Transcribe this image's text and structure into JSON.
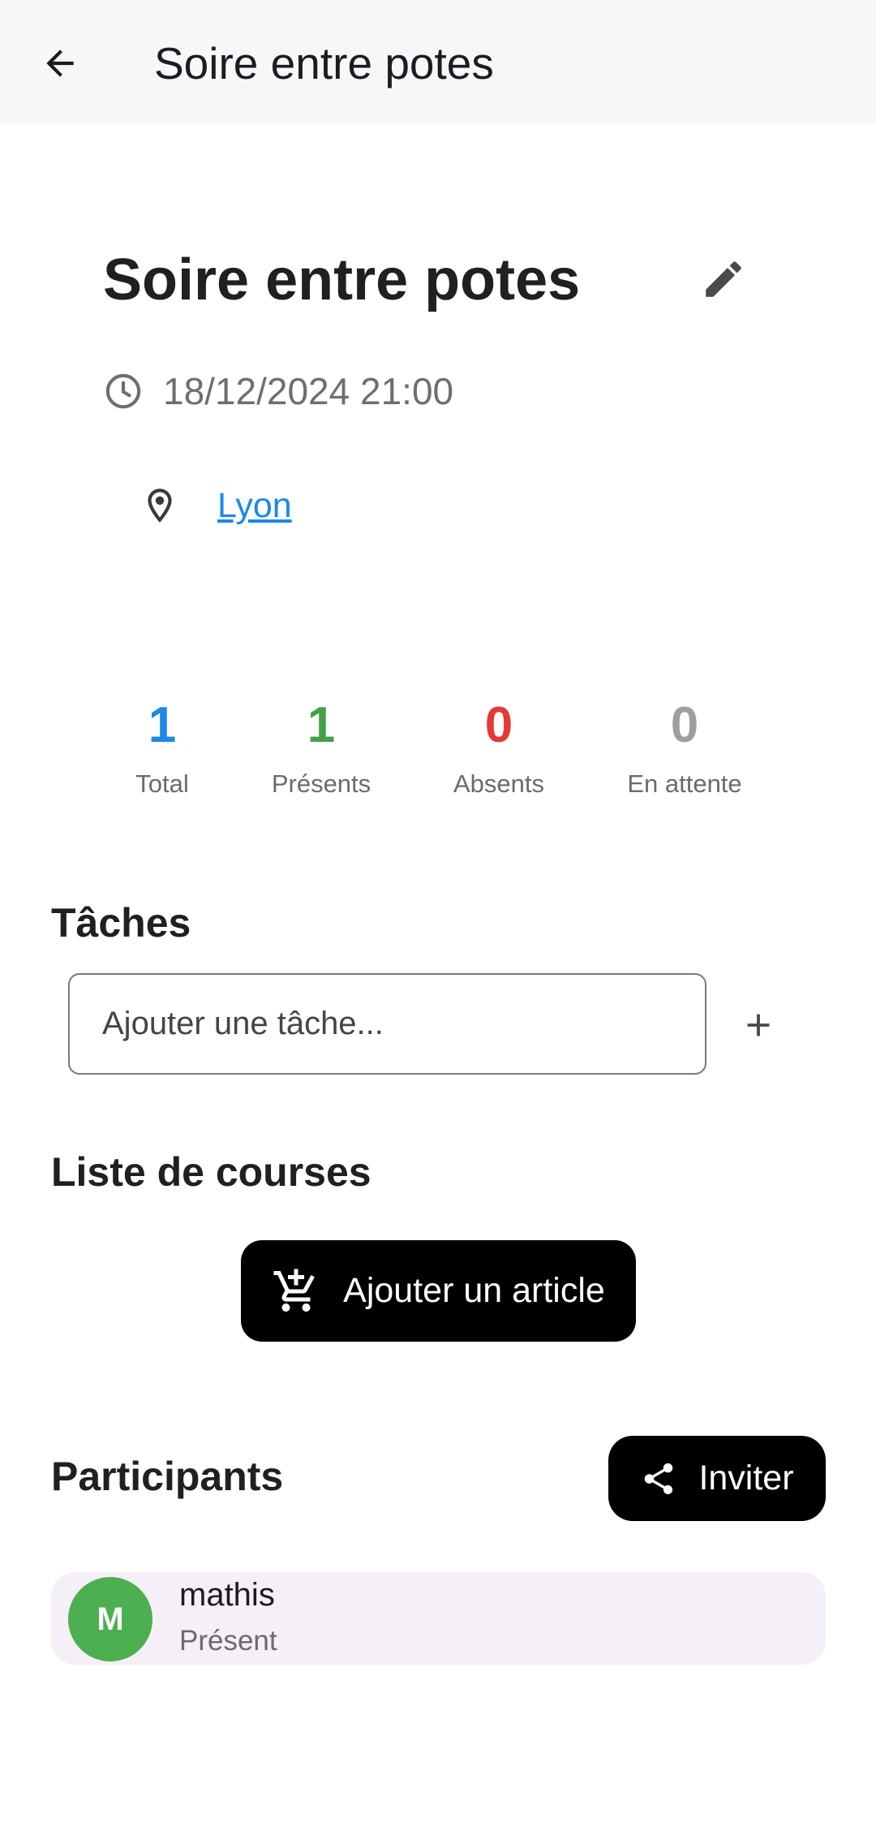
{
  "appbar": {
    "title": "Soire entre potes",
    "back_icon": "arrow-back-icon"
  },
  "event": {
    "title": "Soire entre potes",
    "edit_icon": "pencil-icon",
    "datetime": "18/12/2024 21:00",
    "datetime_icon": "clock-icon",
    "location": "Lyon",
    "location_icon": "map-pin-icon"
  },
  "stats": [
    {
      "value": "1",
      "label": "Total",
      "color": "#1e88e5"
    },
    {
      "value": "1",
      "label": "Présents",
      "color": "#43a047"
    },
    {
      "value": "0",
      "label": "Absents",
      "color": "#e53935"
    },
    {
      "value": "0",
      "label": "En attente",
      "color": "#9e9e9e"
    }
  ],
  "tasks": {
    "title": "Tâches",
    "input_placeholder": "Ajouter une tâche...",
    "add_icon": "plus-icon"
  },
  "shopping": {
    "title": "Liste de courses",
    "add_button_label": "Ajouter un article",
    "add_button_icon": "cart-add-icon"
  },
  "participants": {
    "title": "Participants",
    "invite_label": "Inviter",
    "invite_icon": "share-icon",
    "items": [
      {
        "initial": "M",
        "name": "mathis",
        "status": "Présent",
        "avatar_color": "#4caf50"
      }
    ]
  }
}
